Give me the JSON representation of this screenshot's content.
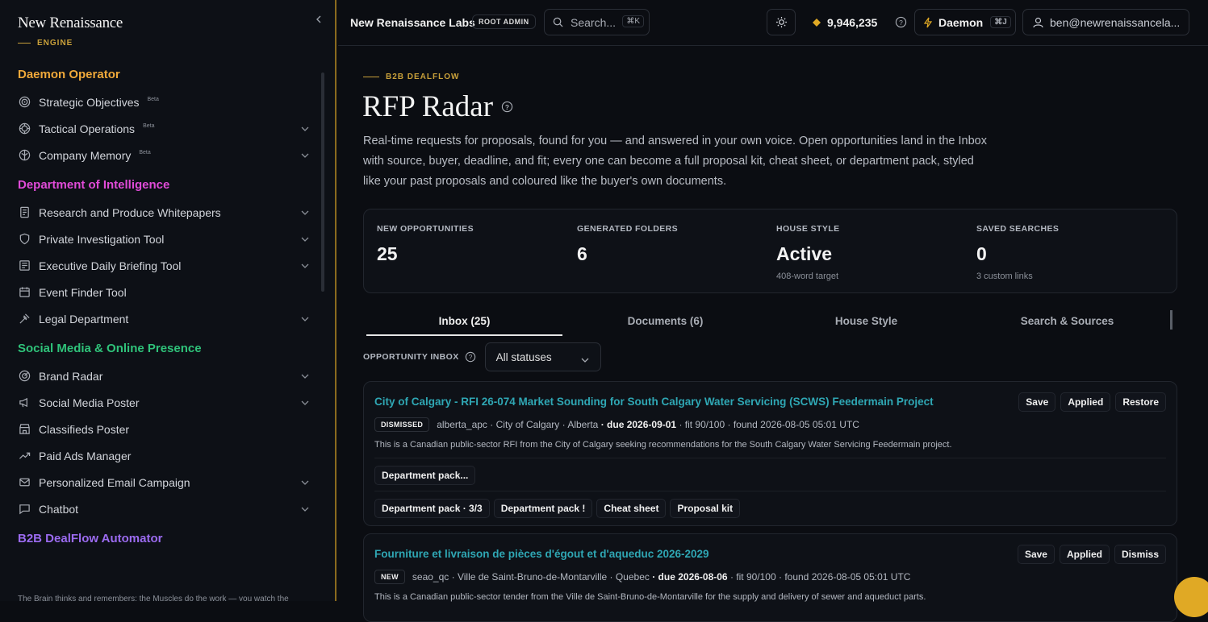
{
  "brand": {
    "name": "New Renaissance",
    "sub": "ENGINE"
  },
  "sidebar": {
    "sections": [
      {
        "title": "Daemon Operator",
        "color": "#f0a93a",
        "items": [
          {
            "label": "Strategic Objectives",
            "icon": "target-icon",
            "beta": "Beta",
            "chevron": false
          },
          {
            "label": "Tactical Operations",
            "icon": "crosshair-icon",
            "beta": "Beta",
            "chevron": true
          },
          {
            "label": "Company Memory",
            "icon": "brain-icon",
            "beta": "Beta",
            "chevron": true
          }
        ]
      },
      {
        "title": "Department of Intelligence",
        "color": "#e04bd8",
        "items": [
          {
            "label": "Research and Produce Whitepapers",
            "icon": "document-icon",
            "chevron": true
          },
          {
            "label": "Private Investigation Tool",
            "icon": "shield-icon",
            "chevron": true
          },
          {
            "label": "Executive Daily Briefing Tool",
            "icon": "newspaper-icon",
            "chevron": true
          },
          {
            "label": "Event Finder Tool",
            "icon": "calendar-icon",
            "chevron": false
          },
          {
            "label": "Legal Department",
            "icon": "gavel-icon",
            "chevron": true
          }
        ]
      },
      {
        "title": "Social Media & Online Presence",
        "color": "#2fc37a",
        "items": [
          {
            "label": "Brand Radar",
            "icon": "radar-icon",
            "chevron": true
          },
          {
            "label": "Social Media Poster",
            "icon": "megaphone-icon",
            "chevron": true
          },
          {
            "label": "Classifieds Poster",
            "icon": "store-icon",
            "chevron": false
          },
          {
            "label": "Paid Ads Manager",
            "icon": "trending-up-icon",
            "chevron": false
          },
          {
            "label": "Personalized Email Campaign",
            "icon": "mail-icon",
            "chevron": true
          },
          {
            "label": "Chatbot",
            "icon": "chat-icon",
            "chevron": true
          }
        ]
      },
      {
        "title": "B2B DealFlow Automator",
        "color": "#9b6bf0",
        "items": []
      }
    ],
    "footer": "The Brain thinks and remembers; the Muscles do the work — you watch the"
  },
  "topbar": {
    "org": "New Renaissance Labs",
    "role": "ROOT ADMIN",
    "search_placeholder": "Search...",
    "search_kbd": "⌘K",
    "credits": "9,946,235",
    "daemon_label": "Daemon",
    "daemon_kbd": "⌘J",
    "user_email": "ben@newrenaissancela..."
  },
  "page": {
    "eyebrow": "B2B DEALFLOW",
    "title": "RFP Radar",
    "intro": "Real-time requests for proposals, found for you — and answered in your own voice. Open opportunities land in the Inbox with source, buyer, deadline, and fit; every one can become a full proposal kit, cheat sheet, or department pack, styled like your past proposals and coloured like the buyer's own documents."
  },
  "stats": [
    {
      "label": "NEW OPPORTUNITIES",
      "value": "25",
      "sub": ""
    },
    {
      "label": "GENERATED FOLDERS",
      "value": "6",
      "sub": ""
    },
    {
      "label": "HOUSE STYLE",
      "value": "Active",
      "sub": "408-word target"
    },
    {
      "label": "SAVED SEARCHES",
      "value": "0",
      "sub": "3 custom links"
    }
  ],
  "tabs": [
    "Inbox (25)",
    "Documents (6)",
    "House Style",
    "Search & Sources"
  ],
  "filter": {
    "label": "OPPORTUNITY INBOX",
    "value": "All statuses"
  },
  "opportunities": [
    {
      "title": "City of Calgary - RFI 26-074 Market Sounding for South Calgary Water Servicing (SCWS) Feedermain Project",
      "actions": [
        "Save",
        "Applied",
        "Restore"
      ],
      "status": "DISMISSED",
      "source": "alberta_apc",
      "buyer": "· City of Calgary",
      "region": "· Alberta",
      "due": "· due 2026-09-01",
      "fit": "· fit 90/100",
      "found": "· found 2026-08-05 05:01 UTC",
      "description": "This is a Canadian public-sector RFI from the City of Calgary seeking recommendations for the South Calgary Water Servicing Feedermain project.",
      "pending": "Department pack...",
      "outputs": [
        "Department pack · 3/3",
        "Department pack !",
        "Cheat sheet",
        "Proposal kit"
      ]
    },
    {
      "title": "Fourniture et livraison de pièces d'égout et d'aqueduc 2026-2029",
      "actions": [
        "Save",
        "Applied",
        "Dismiss"
      ],
      "status": "NEW",
      "source": "seao_qc",
      "buyer": "· Ville de Saint-Bruno-de-Montarville",
      "region": "· Quebec",
      "due": "· due 2026-08-06",
      "fit": "· fit 90/100",
      "found": "· found 2026-08-05 05:01 UTC",
      "description": "This is a Canadian public-sector tender from the Ville de Saint-Bruno-de-Montarville for the supply and delivery of sewer and aqueduct parts."
    }
  ],
  "colors": {
    "accent": "#c9a03a",
    "link": "#2fa7b4",
    "fab": "#e0a925"
  }
}
